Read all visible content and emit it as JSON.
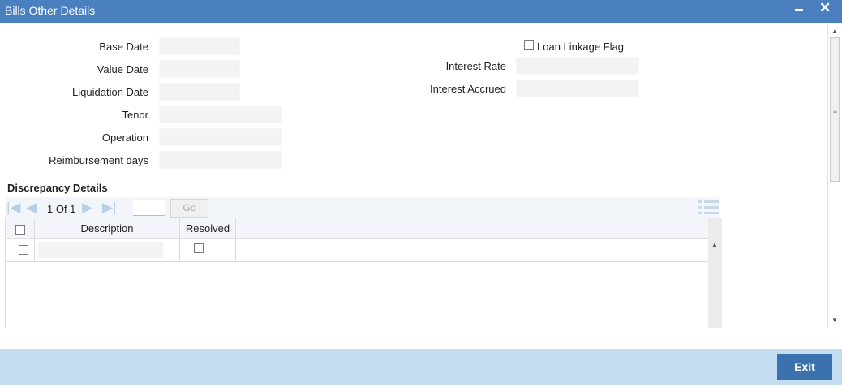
{
  "window": {
    "title": "Bills Other Details",
    "minimize_label": "minimize",
    "close_label": "close"
  },
  "form": {
    "base_date_label": "Base Date",
    "value_date_label": "Value Date",
    "liquidation_date_label": "Liquidation Date",
    "tenor_label": "Tenor",
    "operation_label": "Operation",
    "reimbursement_days_label": "Reimbursement days",
    "loan_linkage_flag_label": "Loan Linkage Flag",
    "interest_rate_label": "Interest Rate",
    "interest_accrued_label": "Interest Accrued",
    "base_date_value": "",
    "value_date_value": "",
    "liquidation_date_value": "",
    "tenor_value": "",
    "operation_value": "",
    "reimbursement_days_value": "",
    "interest_rate_value": "",
    "interest_accrued_value": "",
    "loan_linkage_flag_checked": false
  },
  "discrepancy": {
    "section_title": "Discrepancy Details",
    "pager": {
      "page_info": "1 Of 1",
      "page_input_value": "",
      "go_label": "Go"
    },
    "columns": [
      "Description",
      "Resolved"
    ],
    "rows": [
      {
        "description": "",
        "resolved": false
      }
    ]
  },
  "footer": {
    "exit_label": "Exit"
  },
  "colors": {
    "titlebar": "#4a7fc0",
    "footer": "#c4dcef",
    "exit_button": "#3b72ad",
    "pager_icons": "#b8cfe8"
  }
}
